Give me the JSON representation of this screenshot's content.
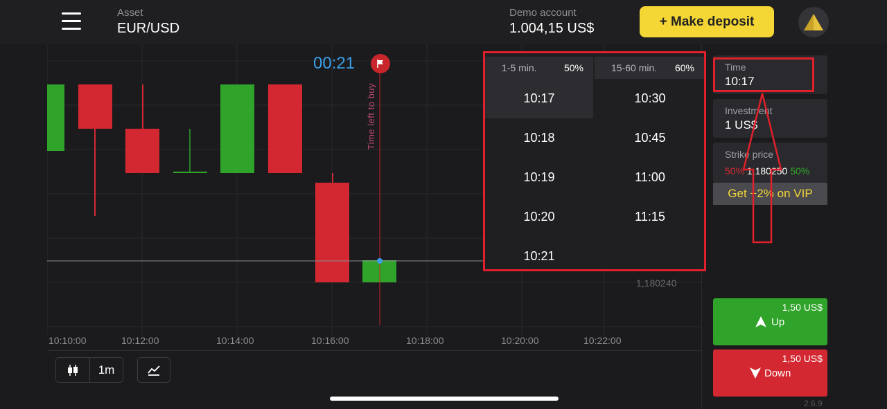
{
  "header": {
    "asset_label": "Asset",
    "asset_value": "EUR/USD",
    "account_label": "Demo account",
    "account_balance": "1.004,15 US$",
    "deposit_label": "+ Make deposit",
    "avatar_icon": "gold-triangle-icon"
  },
  "chart": {
    "timer": "00:21",
    "vertical_label": "Time left to buy",
    "price_line": "1,180240",
    "time_ticks": [
      "10:10:00",
      "10:12:00",
      "10:14:00",
      "10:16:00",
      "10:18:00",
      "10:20:00",
      "10:22:00"
    ],
    "up_color": "#2fa32a",
    "down_color": "#d32832"
  },
  "chart_tools": {
    "candles_icon": "candlestick-icon",
    "interval": "1m",
    "indicator_icon": "indicator-icon"
  },
  "time_picker": {
    "groups": [
      {
        "range": "1-5 min.",
        "payout": "50%",
        "times": [
          "10:17",
          "10:18",
          "10:19",
          "10:20",
          "10:21"
        ]
      },
      {
        "range": "15-60 min.",
        "payout": "60%",
        "times": [
          "10:30",
          "10:45",
          "11:00",
          "11:15"
        ]
      }
    ],
    "selected": "10:17"
  },
  "trade_panel": {
    "time_label": "Time",
    "time_value": "10:17",
    "investment_label": "Investment",
    "investment_value": "1 US$",
    "strike_label": "Strike price",
    "strike_left_pct": "50%",
    "strike_value": "1,180250",
    "strike_right_pct": "50%",
    "vip_label": "Get +2% on VIP",
    "up_amount": "1,50 US$",
    "up_label": "Up",
    "down_amount": "1,50 US$",
    "down_label": "Down",
    "version": "2.6.9"
  }
}
